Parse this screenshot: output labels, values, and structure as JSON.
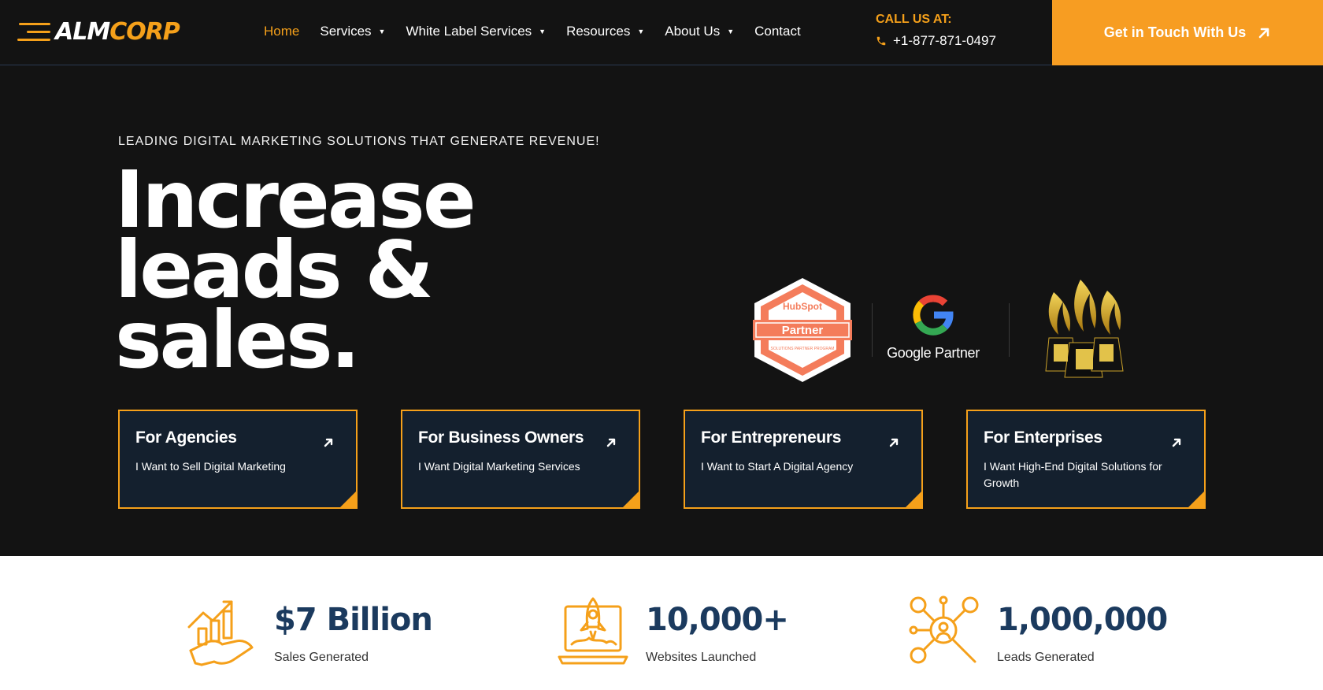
{
  "header": {
    "logo": {
      "part1": "ALM",
      "part2": "CORP"
    },
    "nav": [
      {
        "label": "Home",
        "active": true,
        "has_dropdown": false
      },
      {
        "label": "Services",
        "active": false,
        "has_dropdown": true
      },
      {
        "label": "White Label Services",
        "active": false,
        "has_dropdown": true
      },
      {
        "label": "Resources",
        "active": false,
        "has_dropdown": true
      },
      {
        "label": "About Us",
        "active": false,
        "has_dropdown": true
      },
      {
        "label": "Contact",
        "active": false,
        "has_dropdown": false
      }
    ],
    "call_label": "CALL US AT:",
    "phone": "+1-877-871-0497",
    "phone_icon": "phone-icon",
    "cta_label": "Get in Touch With Us",
    "cta_icon": "arrow-up-right-icon"
  },
  "hero": {
    "eyebrow": "LEADING DIGITAL MARKETING SOLUTIONS THAT GENERATE REVENUE!",
    "headline": [
      "Increase",
      "leads &",
      "sales."
    ],
    "badges": {
      "hubspot_brand": "HubSpot",
      "hubspot_label": "Partner",
      "hubspot_program": "SOLUTIONS PARTNER PROGRAM",
      "google_label": "Google Partner",
      "award_icon": "award-trophies-icon"
    },
    "cards": [
      {
        "title": "For Agencies",
        "subtitle": "I Want to Sell Digital Marketing"
      },
      {
        "title": "For Business Owners",
        "subtitle": "I Want Digital Marketing Services"
      },
      {
        "title": "For Entrepreneurs",
        "subtitle": "I Want to Start A Digital Agency"
      },
      {
        "title": "For Enterprises",
        "subtitle": "I Want High-End Digital Solutions for Growth"
      }
    ]
  },
  "stats": [
    {
      "value": "$7 Billion",
      "label": "Sales Generated",
      "icon": "sales-growth-icon"
    },
    {
      "value": "10,000+",
      "label": "Websites Launched",
      "icon": "rocket-laptop-icon"
    },
    {
      "value": "1,000,000",
      "label": "Leads Generated",
      "icon": "lead-network-icon"
    }
  ],
  "colors": {
    "accent": "#f5a01a",
    "dark_bg": "#131313",
    "card_bg": "#14202e",
    "stat_number": "#1b3a5e"
  }
}
